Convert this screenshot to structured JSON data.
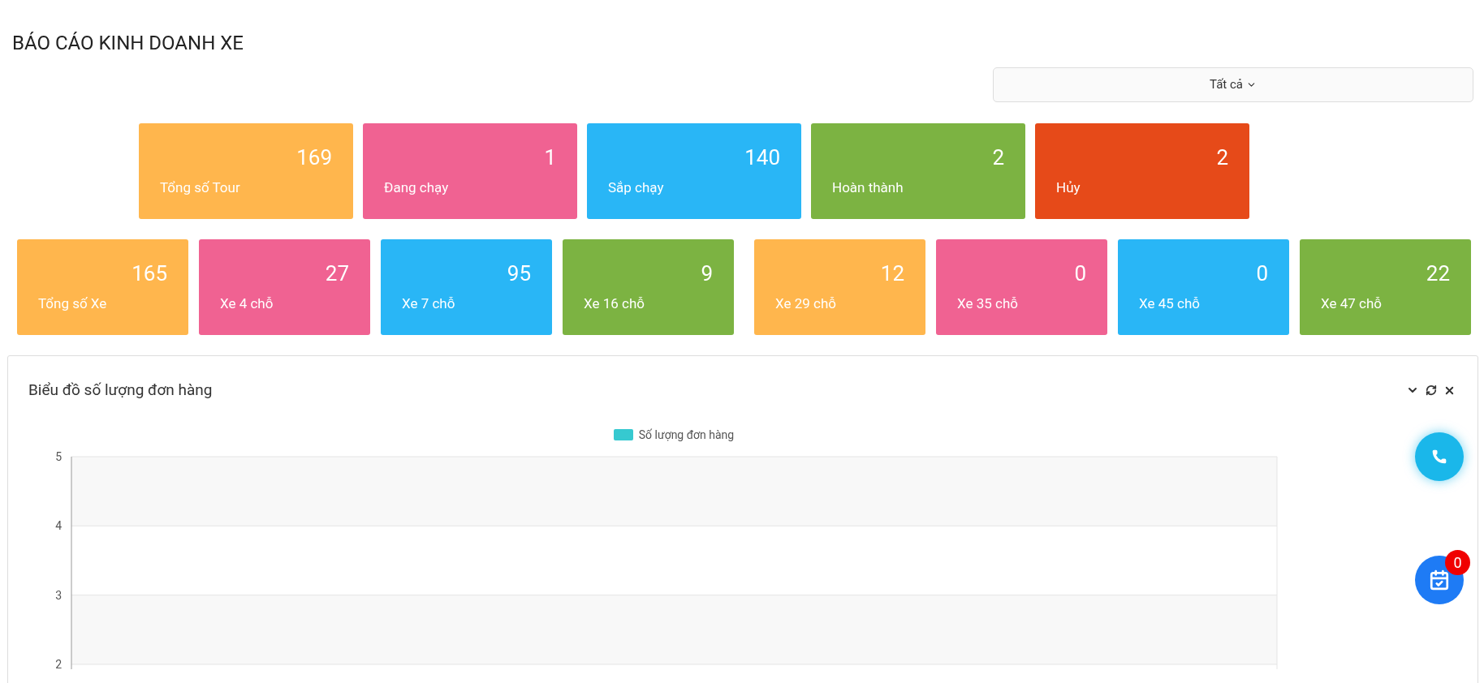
{
  "title": "BÁO CÁO KINH DOANH XE",
  "filter": {
    "value": "Tất cả"
  },
  "tour_stats": [
    {
      "value": "169",
      "label": "Tổng số Tour",
      "color": "#ffb64d"
    },
    {
      "value": "1",
      "label": "Đang chạy",
      "color": "#f06292"
    },
    {
      "value": "140",
      "label": "Sắp chạy",
      "color": "#29b6f6"
    },
    {
      "value": "2",
      "label": "Hoàn thành",
      "color": "#7cb342"
    },
    {
      "value": "2",
      "label": "Hủy",
      "color": "#e64a19"
    }
  ],
  "vehicle_stats": [
    {
      "value": "165",
      "label": "Tổng số Xe",
      "color": "#ffb64d"
    },
    {
      "value": "27",
      "label": "Xe 4 chỗ",
      "color": "#f06292"
    },
    {
      "value": "95",
      "label": "Xe 7 chỗ",
      "color": "#29b6f6"
    },
    {
      "value": "9",
      "label": "Xe 16 chỗ",
      "color": "#7cb342"
    },
    {
      "value": "12",
      "label": "Xe 29 chỗ",
      "color": "#ffb64d"
    },
    {
      "value": "0",
      "label": "Xe 35 chỗ",
      "color": "#f06292"
    },
    {
      "value": "0",
      "label": "Xe 45 chỗ",
      "color": "#29b6f6"
    },
    {
      "value": "22",
      "label": "Xe 47 chỗ",
      "color": "#7cb342"
    }
  ],
  "chart_panel": {
    "title": "Biểu đồ số lượng đơn hàng",
    "chart_data": {
      "type": "bar",
      "ylim": [
        2,
        5
      ],
      "yticks": [
        2,
        3,
        4,
        5
      ],
      "series": [
        {
          "name": "Số lượng đơn hàng",
          "color": "#36c9d0"
        }
      ]
    }
  },
  "reminder_badge": "0"
}
